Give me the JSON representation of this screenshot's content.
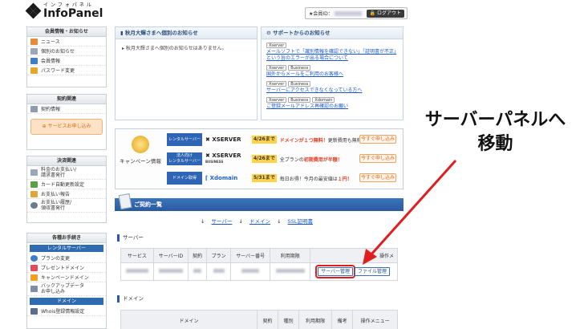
{
  "header": {
    "logo_kana": "インフォパネル",
    "logo_name": "InfoPanel",
    "member_label": "★会員ID：",
    "logout": "ログアウト"
  },
  "sidebar": {
    "member_info": {
      "title": "会員情報・お知らせ",
      "items": [
        "ニュース",
        "個別のお知らせ",
        "会員情報",
        "パスワード変更"
      ]
    },
    "contract": {
      "title": "契約関連",
      "items": [
        "契約情報"
      ],
      "service_button": "サービスお申し込み"
    },
    "payment": {
      "title": "決済関連",
      "items": [
        "料金のお支払い/\n請求書発行",
        "カード自動更新設定",
        "お支払い報告",
        "お支払い履歴/\n領収書発行"
      ]
    },
    "procedures": {
      "title": "各種お手続き",
      "rental_title": "レンタルサーバー",
      "rental_items": [
        "プランの変更",
        "プレゼントドメイン",
        "キャンペーンドメイン",
        "バックアップデータ\nお申し込み"
      ],
      "domain_title": "ドメイン",
      "domain_items": [
        "Whois登録情報設定"
      ]
    }
  },
  "notice_individual": {
    "title": "秋月大輝さまへ個別のお知らせ",
    "body": "秋月大輝さまへ個別のお知らせはありません。"
  },
  "notice_support": {
    "title": "サポートからのお知らせ",
    "items": [
      {
        "tags": [
          "Xserver"
        ],
        "text": "メールソフトで「識別情報を確認できない」「証明書が不正」という旨のエラーが出る場合について"
      },
      {
        "tags": [
          "Xserver",
          "Business"
        ],
        "text": "国外からメールをご利用のお客様へ"
      },
      {
        "tags": [
          "Xserver",
          "Business"
        ],
        "text": "サーバーにアクセスできなくなっている方へ"
      },
      {
        "tags": [
          "Xserver",
          "Business",
          "Xdomain"
        ],
        "text": "ご登録メールアドレス再確認のお願い"
      }
    ]
  },
  "campaign": {
    "label": "キャンペーン情報",
    "rows": [
      {
        "category": "レンタルサーバー",
        "brand": "XSERVER",
        "brand_sub": "",
        "date": "4/26まで",
        "highlight": "ドメインが１つ無料！",
        "text": "更新費用も無料！",
        "button": "今すぐ申し込み"
      },
      {
        "category": "法人向け\nレンタルサーバー",
        "brand": "XSERVER",
        "brand_sub": "BUSINESS",
        "date": "4/26まで",
        "highlight": "初期費用が半額！",
        "text": "全プランの",
        "button": "今すぐ申し込み"
      },
      {
        "category": "ドメイン取得",
        "brand": "Xdomain",
        "brand_sub": "",
        "date": "5/31まで",
        "highlight": "１円！",
        "text": "毎日お得！今月の最安値は",
        "button": "今すぐ申し込み"
      }
    ]
  },
  "contracts": {
    "title": "ご契約一覧",
    "anchors": [
      "サーバー",
      "ドメイン",
      "SSL証明書"
    ],
    "server_section": "サーバー",
    "server_columns": [
      "サービス",
      "サーバーID",
      "契約",
      "プラン",
      "サーバー番号",
      "利用期限",
      "操作メ"
    ],
    "server_buttons": [
      "サーバー管理",
      "ファイル管理"
    ],
    "domain_section": "ドメイン",
    "domain_columns": [
      "ドメイン",
      "契約",
      "種別",
      "利用期限",
      "備考",
      "操作メニュー"
    ]
  },
  "annotation": {
    "line1": "サーバーパネルへ",
    "line2": "移動",
    "color": "#e01e1e"
  }
}
